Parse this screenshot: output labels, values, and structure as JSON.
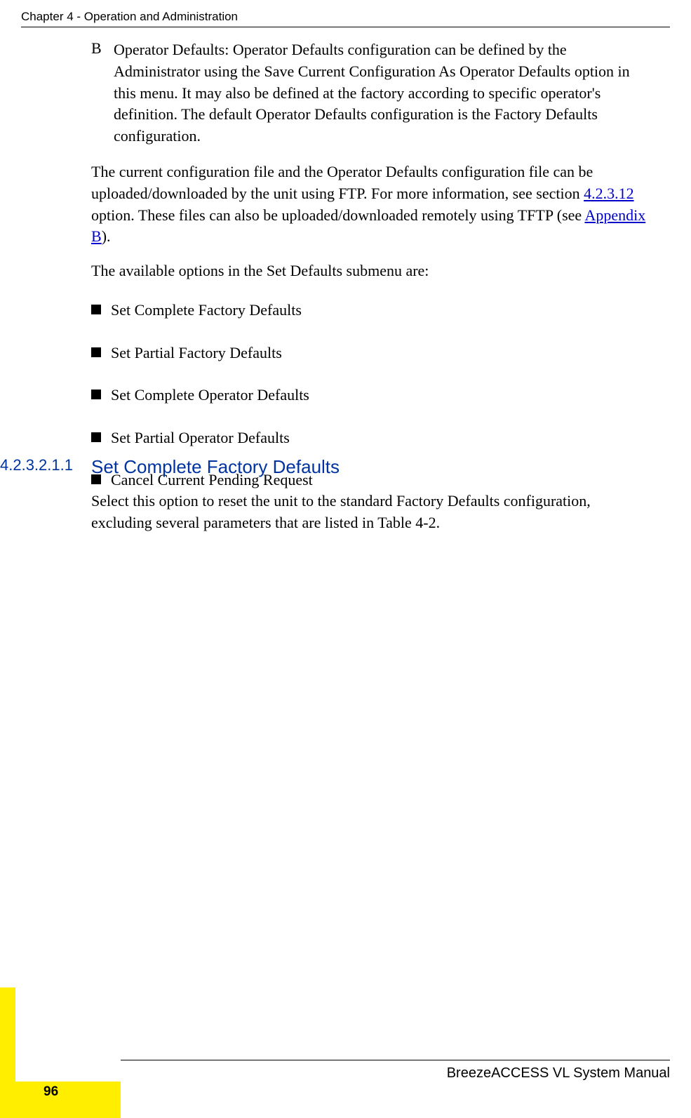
{
  "header": {
    "chapter": "Chapter 4 - Operation and Administration"
  },
  "item_b": {
    "marker": "B",
    "text": "Operator Defaults: Operator Defaults configuration can be defined by the Administrator using the Save Current Configuration As Operator Defaults option in this menu. It may also be defined at the factory according to specific operator's definition. The default Operator Defaults configuration is the Factory Defaults configuration."
  },
  "paragraphs": {
    "p1_pre": "The current configuration file and the Operator Defaults configuration file can be uploaded/downloaded by the unit using FTP. For more information, see section ",
    "p1_link1": "4.2.3.12 ",
    "p1_mid": "option. These files can also be uploaded/downloaded remotely using TFTP (see ",
    "p1_link2": "Appendix B",
    "p1_post": ").",
    "p2": "The available options in the Set Defaults submenu are:"
  },
  "bullets": [
    "Set Complete Factory Defaults",
    "Set Partial Factory Defaults",
    "Set Complete Operator Defaults",
    "Set Partial Operator Defaults",
    "Cancel Current Pending Request"
  ],
  "heading": {
    "number": "4.2.3.2.1.1",
    "title": "Set Complete Factory Defaults"
  },
  "sub_paragraph": "Select this option to reset the unit to the standard Factory Defaults configuration, excluding several parameters that are listed in Table 4-2.",
  "footer": {
    "manual": "BreezeACCESS VL System Manual",
    "page": "96"
  }
}
